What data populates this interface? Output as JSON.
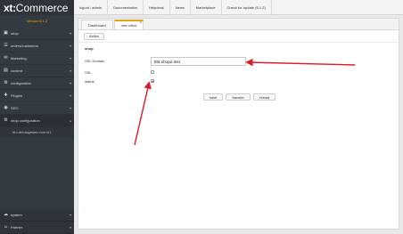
{
  "brand": {
    "part1": "xt:",
    "part2": "Commerce",
    "version": "Version 6.1.2"
  },
  "sidebar": {
    "items": [
      {
        "icon": "shop-icon",
        "glyph": "▣",
        "label": "shop"
      },
      {
        "icon": "order-icon",
        "glyph": "☰",
        "label": "orders/customers"
      },
      {
        "icon": "marketing-icon",
        "glyph": "✉",
        "label": "Marketing"
      },
      {
        "icon": "content-icon",
        "glyph": "▤",
        "label": "content"
      },
      {
        "icon": "config-icon",
        "glyph": "⚙",
        "label": "configuration"
      },
      {
        "icon": "plugin-icon",
        "glyph": "✚",
        "label": "Plugins"
      },
      {
        "icon": "seo-icon",
        "glyph": "◉",
        "label": "SEO"
      },
      {
        "icon": "shop-config-icon",
        "glyph": "⚙",
        "label": "shop configuration"
      }
    ],
    "sub_item": "ttt.x-dev.augewerc.com id:1",
    "bottom": [
      {
        "icon": "system-icon",
        "glyph": "☁",
        "label": "system"
      },
      {
        "icon": "partner-icon",
        "glyph": "☺",
        "label": "Partner"
      }
    ]
  },
  "topbar": {
    "links": [
      "logout : admin",
      "Documentation",
      "Helpdesk",
      "News",
      "Marketplace",
      "Check for update (6.1.2)"
    ]
  },
  "tabs": [
    {
      "label": "Dashboard",
      "active": false
    },
    {
      "label": "new client",
      "active": true,
      "close": "⊗"
    }
  ],
  "toolbar": {
    "action_label": "Action"
  },
  "form": {
    "section_title": "shop",
    "ssl_domain_label": "SSL Domain",
    "ssl_domain_value": "ttt5.shop2.test",
    "ssl_label": "SSL",
    "ssl_checked": false,
    "status_label": "status",
    "status_checked": true,
    "status_mark": "✔"
  },
  "actions": {
    "save": "save",
    "transfer": "transfer",
    "reload": "reload"
  },
  "colors": {
    "sidebar_bg": "#333a40",
    "accent": "#e2a21a",
    "arrow": "#e0182a"
  }
}
